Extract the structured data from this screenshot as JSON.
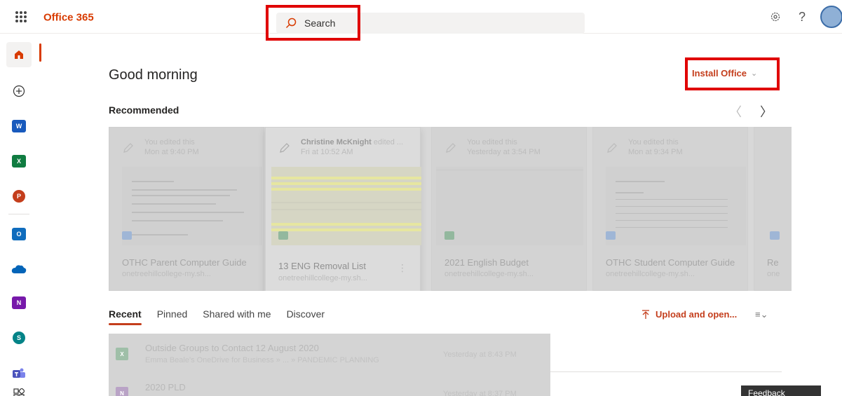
{
  "app": {
    "brand": "Office 365"
  },
  "search": {
    "placeholder": "Search"
  },
  "header": {
    "icons": [
      "settings-icon",
      "help-icon"
    ],
    "help_label": "?"
  },
  "rail": {
    "items": [
      {
        "name": "home",
        "icon": "home-icon",
        "color": "#d83b01"
      },
      {
        "name": "create",
        "icon": "plus-circle-icon"
      },
      {
        "name": "word",
        "icon": "word-icon",
        "color": "#185abd",
        "letter": "W"
      },
      {
        "name": "excel",
        "icon": "excel-icon",
        "color": "#107c41",
        "letter": "X"
      },
      {
        "name": "powerpoint",
        "icon": "powerpoint-icon",
        "color": "#c43e1c",
        "letter": "P"
      },
      {
        "name": "outlook",
        "icon": "outlook-icon",
        "color": "#0f6cbd",
        "letter": "O"
      },
      {
        "name": "onedrive",
        "icon": "onedrive-icon",
        "color": "#0364b8"
      },
      {
        "name": "onenote",
        "icon": "onenote-icon",
        "color": "#7719aa",
        "letter": "N"
      },
      {
        "name": "sharepoint",
        "icon": "sharepoint-icon",
        "color": "#038387",
        "letter": "S"
      },
      {
        "name": "teams",
        "icon": "teams-icon",
        "color": "#4b53bc"
      },
      {
        "name": "all-apps",
        "icon": "all-apps-icon"
      }
    ]
  },
  "main": {
    "greeting": "Good morning",
    "install_label": "Install Office",
    "recommended_title": "Recommended",
    "recommended": [
      {
        "who": "You edited this",
        "when": "Mon at 9:40 PM",
        "name": "OTHC Parent Computer Guide",
        "location": "onetreehillcollege-my.sh...",
        "type": "word"
      },
      {
        "who_name": "Christine McKnight",
        "who_suffix": " edited ...",
        "when": "Fri at 10:52 AM",
        "name": "13 ENG Removal List",
        "location": "onetreehillcollege-my.sh...",
        "type": "excel"
      },
      {
        "who": "You edited this",
        "when": "Yesterday at 3:54 PM",
        "name": "2021 English Budget",
        "location": "onetreehillcollege-my.sh...",
        "type": "excel"
      },
      {
        "who": "You edited this",
        "when": "Mon at 9:34 PM",
        "name": "OTHC Student Computer Guide",
        "location": "onetreehillcollege-my.sh...",
        "type": "word"
      },
      {
        "name": "Re",
        "location": "one",
        "type": "word"
      }
    ],
    "tabs": [
      "Recent",
      "Pinned",
      "Shared with me",
      "Discover"
    ],
    "upload_label": "Upload and open...",
    "recent_files": [
      {
        "name": "Outside Groups to Contact 12 August 2020",
        "path": "Emma Beale's OneDrive for Business » ... » PANDEMIC PLANNING",
        "time": "Yesterday at 8:43 PM",
        "type": "excel"
      },
      {
        "name": "2020 PLD",
        "path": "",
        "time": "Yesterday at 8:37 PM",
        "type": "onenote"
      }
    ],
    "feedback_label": "Feedback"
  }
}
